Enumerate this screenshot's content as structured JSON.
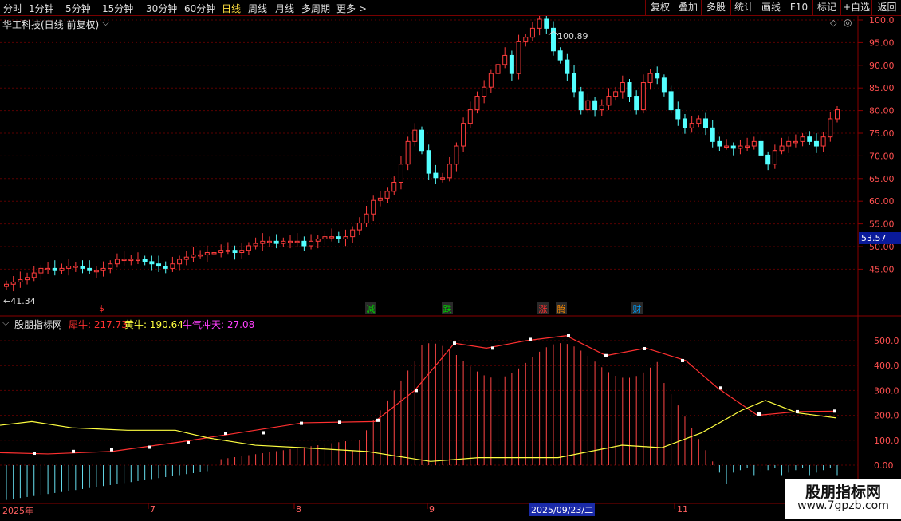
{
  "toolbar": {
    "periods": [
      "分时",
      "1分钟",
      "5分钟",
      "15分钟",
      "30分钟",
      "60分钟",
      "日线",
      "周线",
      "月线",
      "多周期"
    ],
    "active": "日线",
    "more": "更多 >",
    "right": [
      "复权",
      "叠加",
      "多股",
      "统计",
      "画线",
      "F10",
      "+自选",
      "返回"
    ]
  },
  "stock": {
    "title": "华工科技(日线 前复权)",
    "high_label": "100.89",
    "low_label": "41.34",
    "current_price_tag": "53.57"
  },
  "price_axis": [
    "100.0",
    "95.00",
    "90.00",
    "85.00",
    "80.00",
    "75.00",
    "70.00",
    "65.00",
    "60.00",
    "55.00",
    "50.00",
    "45.00"
  ],
  "event_marks": [
    {
      "text": "$",
      "color": "#ff3030"
    },
    {
      "text": "减",
      "color": "#00d000"
    },
    {
      "text": "跌",
      "color": "#00d000"
    },
    {
      "text": "涨",
      "color": "#ff3030"
    },
    {
      "text": "腾",
      "color": "#ff8c00"
    },
    {
      "text": "财",
      "color": "#00a0ff"
    }
  ],
  "indicator": {
    "name": "股朋指标网",
    "line1_label": "犀牛: 217.73",
    "line2_label": "黄牛: 190.64",
    "line3_label": "牛气冲天: 27.08",
    "colors": {
      "line1": "#ff3030",
      "line2": "#ffff40",
      "line3": "#ff40ff"
    },
    "axis": [
      "500.0",
      "400.0",
      "300.0",
      "200.0",
      "100.0",
      "0.00"
    ]
  },
  "date_axis": {
    "labels": [
      "2025年",
      "7",
      "8",
      "9",
      "11"
    ],
    "cursor_date": "2025/09/23/二"
  },
  "watermark": {
    "title": "股朋指标网",
    "url": "www.7gpzb.com"
  }
}
